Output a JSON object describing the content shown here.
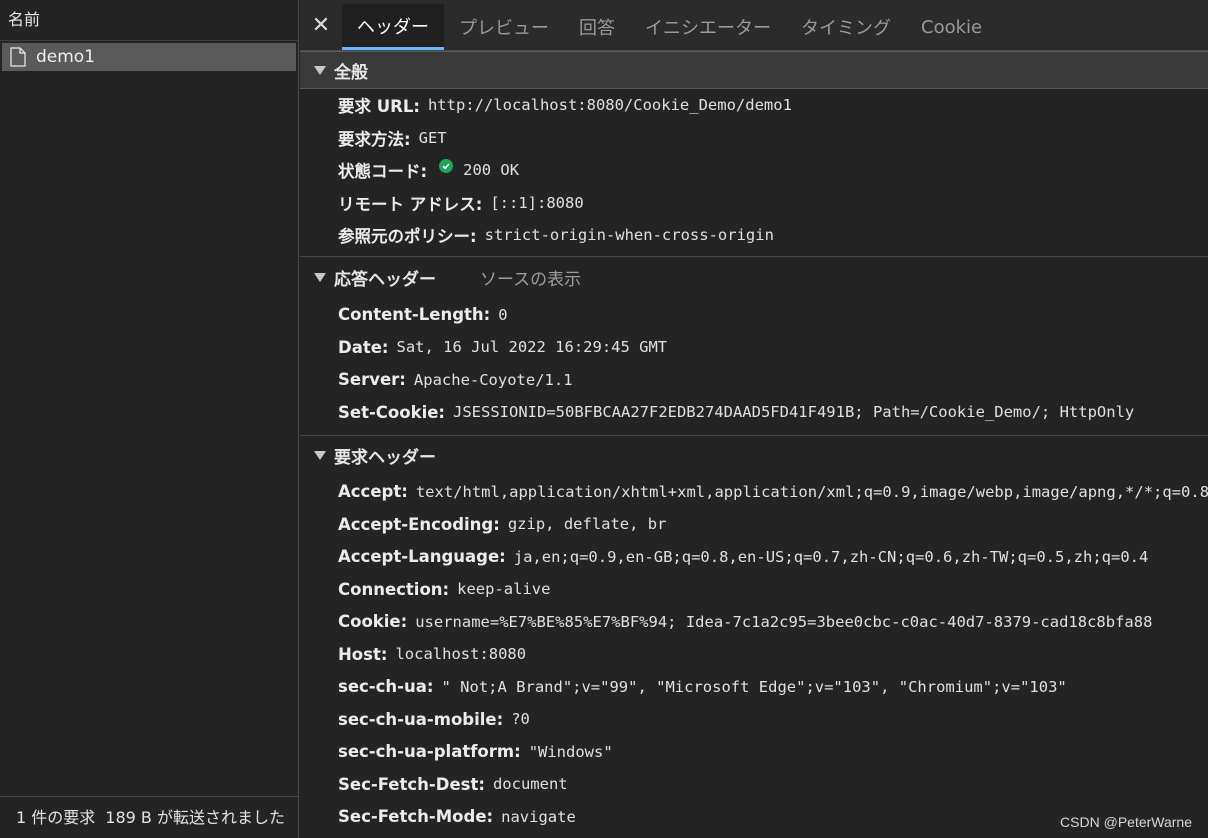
{
  "left": {
    "header": "名前",
    "request": "demo1",
    "status": {
      "count": "1 件の要求",
      "size": "189 B が転送されました"
    }
  },
  "tabs": [
    "ヘッダー",
    "プレビュー",
    "回答",
    "イニシエーター",
    "タイミング",
    "Cookie"
  ],
  "general": {
    "title": "全般",
    "rows": [
      {
        "k": "要求 URL:",
        "v": "http://localhost:8080/Cookie_Demo/demo1"
      },
      {
        "k": "要求方法:",
        "v": "GET"
      },
      {
        "k": "状態コード:",
        "v": "200 OK"
      },
      {
        "k": "リモート アドレス:",
        "v": "[::1]:8080"
      },
      {
        "k": "参照元のポリシー:",
        "v": "strict-origin-when-cross-origin"
      }
    ]
  },
  "response": {
    "title": "応答ヘッダー",
    "view_source": "ソースの表示",
    "rows": [
      {
        "k": "Content-Length:",
        "v": "0"
      },
      {
        "k": "Date:",
        "v": "Sat, 16 Jul 2022 16:29:45 GMT"
      },
      {
        "k": "Server:",
        "v": "Apache-Coyote/1.1"
      },
      {
        "k": "Set-Cookie:",
        "v": "JSESSIONID=50BFBCAA27F2EDB274DAAD5FD41F491B; Path=/Cookie_Demo/; HttpOnly"
      }
    ]
  },
  "request": {
    "title": "要求ヘッダー",
    "rows": [
      {
        "k": "Accept:",
        "v": "text/html,application/xhtml+xml,application/xml;q=0.9,image/webp,image/apng,*/*;q=0.8"
      },
      {
        "k": "Accept-Encoding:",
        "v": "gzip, deflate, br"
      },
      {
        "k": "Accept-Language:",
        "v": "ja,en;q=0.9,en-GB;q=0.8,en-US;q=0.7,zh-CN;q=0.6,zh-TW;q=0.5,zh;q=0.4"
      },
      {
        "k": "Connection:",
        "v": "keep-alive"
      },
      {
        "k": "Cookie:",
        "v": "username=%E7%BE%85%E7%BF%94; Idea-7c1a2c95=3bee0cbc-c0ac-40d7-8379-cad18c8bfa88"
      },
      {
        "k": "Host:",
        "v": "localhost:8080"
      },
      {
        "k": "sec-ch-ua:",
        "v": "\" Not;A Brand\";v=\"99\", \"Microsoft Edge\";v=\"103\", \"Chromium\";v=\"103\""
      },
      {
        "k": "sec-ch-ua-mobile:",
        "v": "?0"
      },
      {
        "k": "sec-ch-ua-platform:",
        "v": "\"Windows\""
      },
      {
        "k": "Sec-Fetch-Dest:",
        "v": "document"
      },
      {
        "k": "Sec-Fetch-Mode:",
        "v": "navigate"
      }
    ]
  },
  "watermark": "CSDN @PeterWarne",
  "icons": {
    "close": "close-icon",
    "file": "file-icon",
    "status_ok": "check-circle-icon",
    "section": "triangle-down-icon"
  },
  "colors": {
    "tab_underline": "#6cb6ff",
    "status_ok": "#1fa55b"
  }
}
